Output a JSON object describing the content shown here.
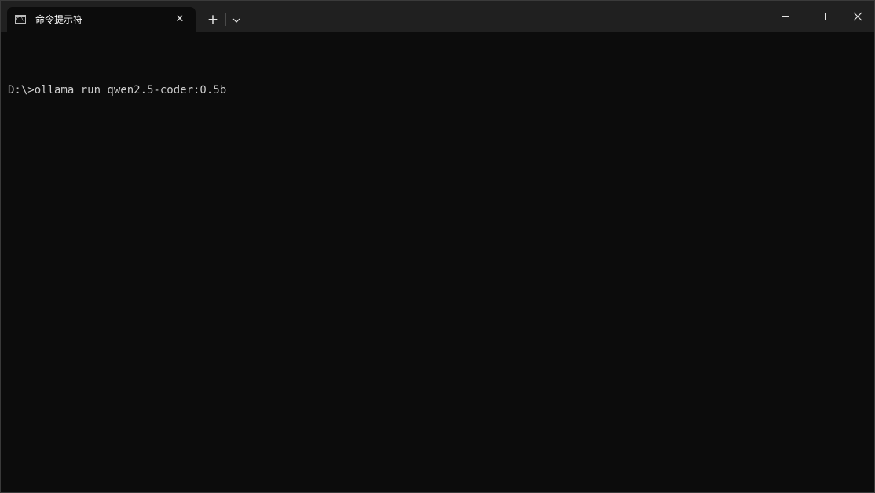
{
  "window": {
    "tab_title": "命令提示符",
    "tab_icon_text": "C:\\"
  },
  "terminal": {
    "lines": [
      "D:\\>ollama run qwen2.5-coder:0.5b"
    ]
  },
  "icons": {
    "tab_icon": "cmd-icon",
    "close_tab": "close-icon",
    "new_tab": "plus-icon",
    "dropdown": "chevron-down-icon",
    "minimize": "minimize-icon",
    "maximize": "maximize-icon",
    "close_window": "close-icon"
  },
  "colors": {
    "terminal_bg": "#0c0c0c",
    "titlebar_bg": "#202020",
    "text": "#cccccc"
  }
}
